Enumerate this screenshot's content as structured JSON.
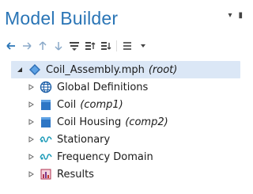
{
  "panel": {
    "title": "Model Builder",
    "header_buttons": [
      "▾",
      "▮"
    ]
  },
  "toolbar": {
    "buttons": [
      "arrow-left-icon",
      "arrow-right-icon",
      "arrow-up-icon",
      "arrow-down-icon",
      "filter-icon",
      "collapse-all-icon",
      "expand-all-icon",
      "list-view-icon",
      "dropdown-icon"
    ]
  },
  "tree": {
    "root": {
      "label": "Coil_Assembly.mph",
      "tag": "(root)",
      "expanded": true
    },
    "items": [
      {
        "label": "Global Definitions",
        "tag": "",
        "icon": "globe-icon"
      },
      {
        "label": "Coil",
        "tag": "(comp1)",
        "icon": "component-icon"
      },
      {
        "label": "Coil Housing",
        "tag": "(comp2)",
        "icon": "component-icon"
      },
      {
        "label": "Stationary",
        "tag": "",
        "icon": "study-icon"
      },
      {
        "label": "Frequency Domain",
        "tag": "",
        "icon": "study-icon"
      },
      {
        "label": "Results",
        "tag": "",
        "icon": "results-icon"
      }
    ]
  }
}
